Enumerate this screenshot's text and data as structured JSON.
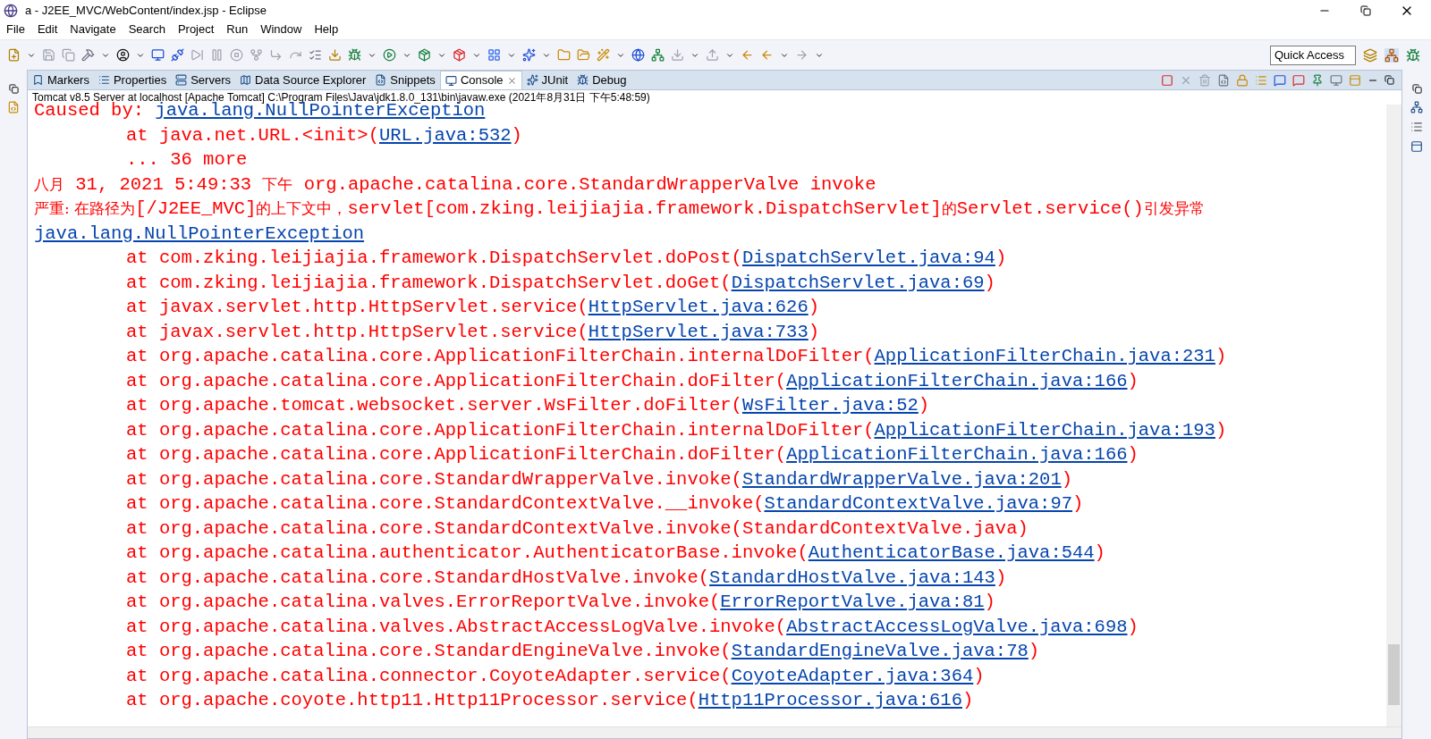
{
  "window": {
    "title": "a - J2EE_MVC/WebContent/index.jsp - Eclipse"
  },
  "menu": [
    "File",
    "Edit",
    "Navigate",
    "Search",
    "Project",
    "Run",
    "Window",
    "Help"
  ],
  "quick_access": {
    "placeholder": "Quick Access"
  },
  "tabs": [
    {
      "label": "Markers",
      "selected": false
    },
    {
      "label": "Properties",
      "selected": false
    },
    {
      "label": "Servers",
      "selected": false
    },
    {
      "label": "Data Source Explorer",
      "selected": false
    },
    {
      "label": "Snippets",
      "selected": false
    },
    {
      "label": "Console",
      "selected": true
    },
    {
      "label": "JUnit",
      "selected": false
    },
    {
      "label": "Debug",
      "selected": false
    }
  ],
  "console": {
    "header": "Tomcat v8.5 Server at localhost [Apache Tomcat] C:\\Program Files\\Java\\jdk1.8.0_131\\bin\\javaw.exe (2021年8月31日 下午5:48:59)",
    "lines": [
      {
        "indented": false,
        "segments": [
          {
            "kind": "plain",
            "text": "Caused by: "
          },
          {
            "kind": "link",
            "text": "java.lang.NullPointerException"
          }
        ]
      },
      {
        "indented": true,
        "segments": [
          {
            "kind": "plain",
            "text": "at java.net.URL.<init>("
          },
          {
            "kind": "link",
            "text": "URL.java:532"
          },
          {
            "kind": "plain",
            "text": ")"
          }
        ]
      },
      {
        "indented": true,
        "segments": [
          {
            "kind": "plain",
            "text": "... 36 more"
          }
        ]
      },
      {
        "indented": false,
        "segments": [
          {
            "kind": "cjk",
            "text": "八月"
          },
          {
            "kind": "plain",
            "text": " 31, 2021 5:49:33 "
          },
          {
            "kind": "cjk",
            "text": "下午"
          },
          {
            "kind": "plain",
            "text": " org.apache.catalina.core.StandardWrapperValve invoke"
          }
        ]
      },
      {
        "indented": false,
        "segments": [
          {
            "kind": "cjk",
            "text": "严重: 在路径为"
          },
          {
            "kind": "plain",
            "text": "[/J2EE_MVC]"
          },
          {
            "kind": "cjk",
            "text": "的上下文中，"
          },
          {
            "kind": "plain",
            "text": "servlet[com.zking.leijiajia.framework.DispatchServlet]"
          },
          {
            "kind": "cjk",
            "text": "的"
          },
          {
            "kind": "plain",
            "text": "Servlet.service()"
          },
          {
            "kind": "cjk",
            "text": "引发异常"
          }
        ]
      },
      {
        "indented": false,
        "segments": [
          {
            "kind": "link",
            "text": "java.lang.NullPointerException"
          }
        ]
      },
      {
        "indented": true,
        "segments": [
          {
            "kind": "plain",
            "text": "at com.zking.leijiajia.framework.DispatchServlet.doPost("
          },
          {
            "kind": "link",
            "text": "DispatchServlet.java:94"
          },
          {
            "kind": "plain",
            "text": ")"
          }
        ]
      },
      {
        "indented": true,
        "segments": [
          {
            "kind": "plain",
            "text": "at com.zking.leijiajia.framework.DispatchServlet.doGet("
          },
          {
            "kind": "link",
            "text": "DispatchServlet.java:69"
          },
          {
            "kind": "plain",
            "text": ")"
          }
        ]
      },
      {
        "indented": true,
        "segments": [
          {
            "kind": "plain",
            "text": "at javax.servlet.http.HttpServlet.service("
          },
          {
            "kind": "link",
            "text": "HttpServlet.java:626"
          },
          {
            "kind": "plain",
            "text": ")"
          }
        ]
      },
      {
        "indented": true,
        "segments": [
          {
            "kind": "plain",
            "text": "at javax.servlet.http.HttpServlet.service("
          },
          {
            "kind": "link",
            "text": "HttpServlet.java:733"
          },
          {
            "kind": "plain",
            "text": ")"
          }
        ]
      },
      {
        "indented": true,
        "segments": [
          {
            "kind": "plain",
            "text": "at org.apache.catalina.core.ApplicationFilterChain.internalDoFilter("
          },
          {
            "kind": "link",
            "text": "ApplicationFilterChain.java:231"
          },
          {
            "kind": "plain",
            "text": ")"
          }
        ]
      },
      {
        "indented": true,
        "segments": [
          {
            "kind": "plain",
            "text": "at org.apache.catalina.core.ApplicationFilterChain.doFilter("
          },
          {
            "kind": "link",
            "text": "ApplicationFilterChain.java:166"
          },
          {
            "kind": "plain",
            "text": ")"
          }
        ]
      },
      {
        "indented": true,
        "segments": [
          {
            "kind": "plain",
            "text": "at org.apache.tomcat.websocket.server.WsFilter.doFilter("
          },
          {
            "kind": "link",
            "text": "WsFilter.java:52"
          },
          {
            "kind": "plain",
            "text": ")"
          }
        ]
      },
      {
        "indented": true,
        "segments": [
          {
            "kind": "plain",
            "text": "at org.apache.catalina.core.ApplicationFilterChain.internalDoFilter("
          },
          {
            "kind": "link",
            "text": "ApplicationFilterChain.java:193"
          },
          {
            "kind": "plain",
            "text": ")"
          }
        ]
      },
      {
        "indented": true,
        "segments": [
          {
            "kind": "plain",
            "text": "at org.apache.catalina.core.ApplicationFilterChain.doFilter("
          },
          {
            "kind": "link",
            "text": "ApplicationFilterChain.java:166"
          },
          {
            "kind": "plain",
            "text": ")"
          }
        ]
      },
      {
        "indented": true,
        "segments": [
          {
            "kind": "plain",
            "text": "at org.apache.catalina.core.StandardWrapperValve.invoke("
          },
          {
            "kind": "link",
            "text": "StandardWrapperValve.java:201"
          },
          {
            "kind": "plain",
            "text": ")"
          }
        ]
      },
      {
        "indented": true,
        "segments": [
          {
            "kind": "plain",
            "text": "at org.apache.catalina.core.StandardContextValve.__invoke("
          },
          {
            "kind": "link",
            "text": "StandardContextValve.java:97"
          },
          {
            "kind": "plain",
            "text": ")"
          }
        ]
      },
      {
        "indented": true,
        "segments": [
          {
            "kind": "plain",
            "text": "at org.apache.catalina.core.StandardContextValve.invoke(StandardContextValve.java)"
          }
        ]
      },
      {
        "indented": true,
        "segments": [
          {
            "kind": "plain",
            "text": "at org.apache.catalina.authenticator.AuthenticatorBase.invoke("
          },
          {
            "kind": "link",
            "text": "AuthenticatorBase.java:544"
          },
          {
            "kind": "plain",
            "text": ")"
          }
        ]
      },
      {
        "indented": true,
        "segments": [
          {
            "kind": "plain",
            "text": "at org.apache.catalina.core.StandardHostValve.invoke("
          },
          {
            "kind": "link",
            "text": "StandardHostValve.java:143"
          },
          {
            "kind": "plain",
            "text": ")"
          }
        ]
      },
      {
        "indented": true,
        "segments": [
          {
            "kind": "plain",
            "text": "at org.apache.catalina.valves.ErrorReportValve.invoke("
          },
          {
            "kind": "link",
            "text": "ErrorReportValve.java:81"
          },
          {
            "kind": "plain",
            "text": ")"
          }
        ]
      },
      {
        "indented": true,
        "segments": [
          {
            "kind": "plain",
            "text": "at org.apache.catalina.valves.AbstractAccessLogValve.invoke("
          },
          {
            "kind": "link",
            "text": "AbstractAccessLogValve.java:698"
          },
          {
            "kind": "plain",
            "text": ")"
          }
        ]
      },
      {
        "indented": true,
        "segments": [
          {
            "kind": "plain",
            "text": "at org.apache.catalina.core.StandardEngineValve.invoke("
          },
          {
            "kind": "link",
            "text": "StandardEngineValve.java:78"
          },
          {
            "kind": "plain",
            "text": ")"
          }
        ]
      },
      {
        "indented": true,
        "segments": [
          {
            "kind": "plain",
            "text": "at org.apache.catalina.connector.CoyoteAdapter.service("
          },
          {
            "kind": "link",
            "text": "CoyoteAdapter.java:364"
          },
          {
            "kind": "plain",
            "text": ")"
          }
        ]
      },
      {
        "indented": true,
        "segments": [
          {
            "kind": "plain",
            "text": "at org.apache.coyote.http11.Http11Processor.service("
          },
          {
            "kind": "link",
            "text": "Http11Processor.java:616"
          },
          {
            "kind": "plain",
            "text": ")"
          }
        ]
      }
    ]
  }
}
